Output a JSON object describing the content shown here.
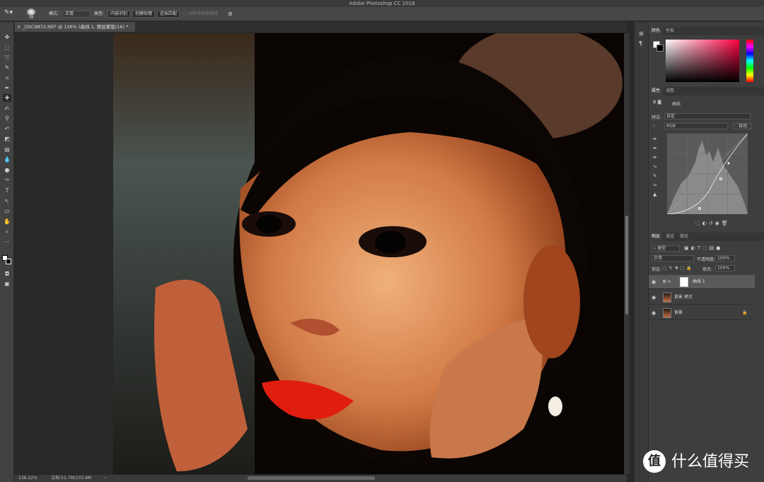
{
  "app": {
    "title": "Adobe Photoshop CC 2018"
  },
  "options_bar": {
    "brush_size": "38",
    "mode_label": "模式:",
    "mode_value": "正常",
    "type_label": "类型:",
    "type_options": [
      "内容识别",
      "创建纹理",
      "近似匹配"
    ],
    "sample_all_layers": "对所有图层取样"
  },
  "document": {
    "tab_title": "_DSC9872.NEF @ 136% (曲线 1, 图层蒙版/16) *",
    "zoom": "136.12%",
    "doc_size": "文档:51.7M/103.4M"
  },
  "color_panel": {
    "tabs": [
      "颜色",
      "色板"
    ]
  },
  "properties_panel": {
    "tabs": [
      "属性",
      "调整"
    ],
    "title": "曲线",
    "preset_label": "预设:",
    "preset_value": "自定",
    "channel": "RGB",
    "auto_button": "自动"
  },
  "layers_panel": {
    "tabs": [
      "图层",
      "通道",
      "路径"
    ],
    "filter_kind": "类型",
    "blend_mode": "正常",
    "opacity_label": "不透明度:",
    "opacity_value": "100%",
    "lock_label": "锁定:",
    "fill_label": "填充:",
    "fill_value": "100%",
    "layers": [
      {
        "name": "曲线 1"
      },
      {
        "name": "背景 拷贝"
      },
      {
        "name": "背景"
      }
    ]
  },
  "watermark": {
    "text": "什么值得买"
  }
}
